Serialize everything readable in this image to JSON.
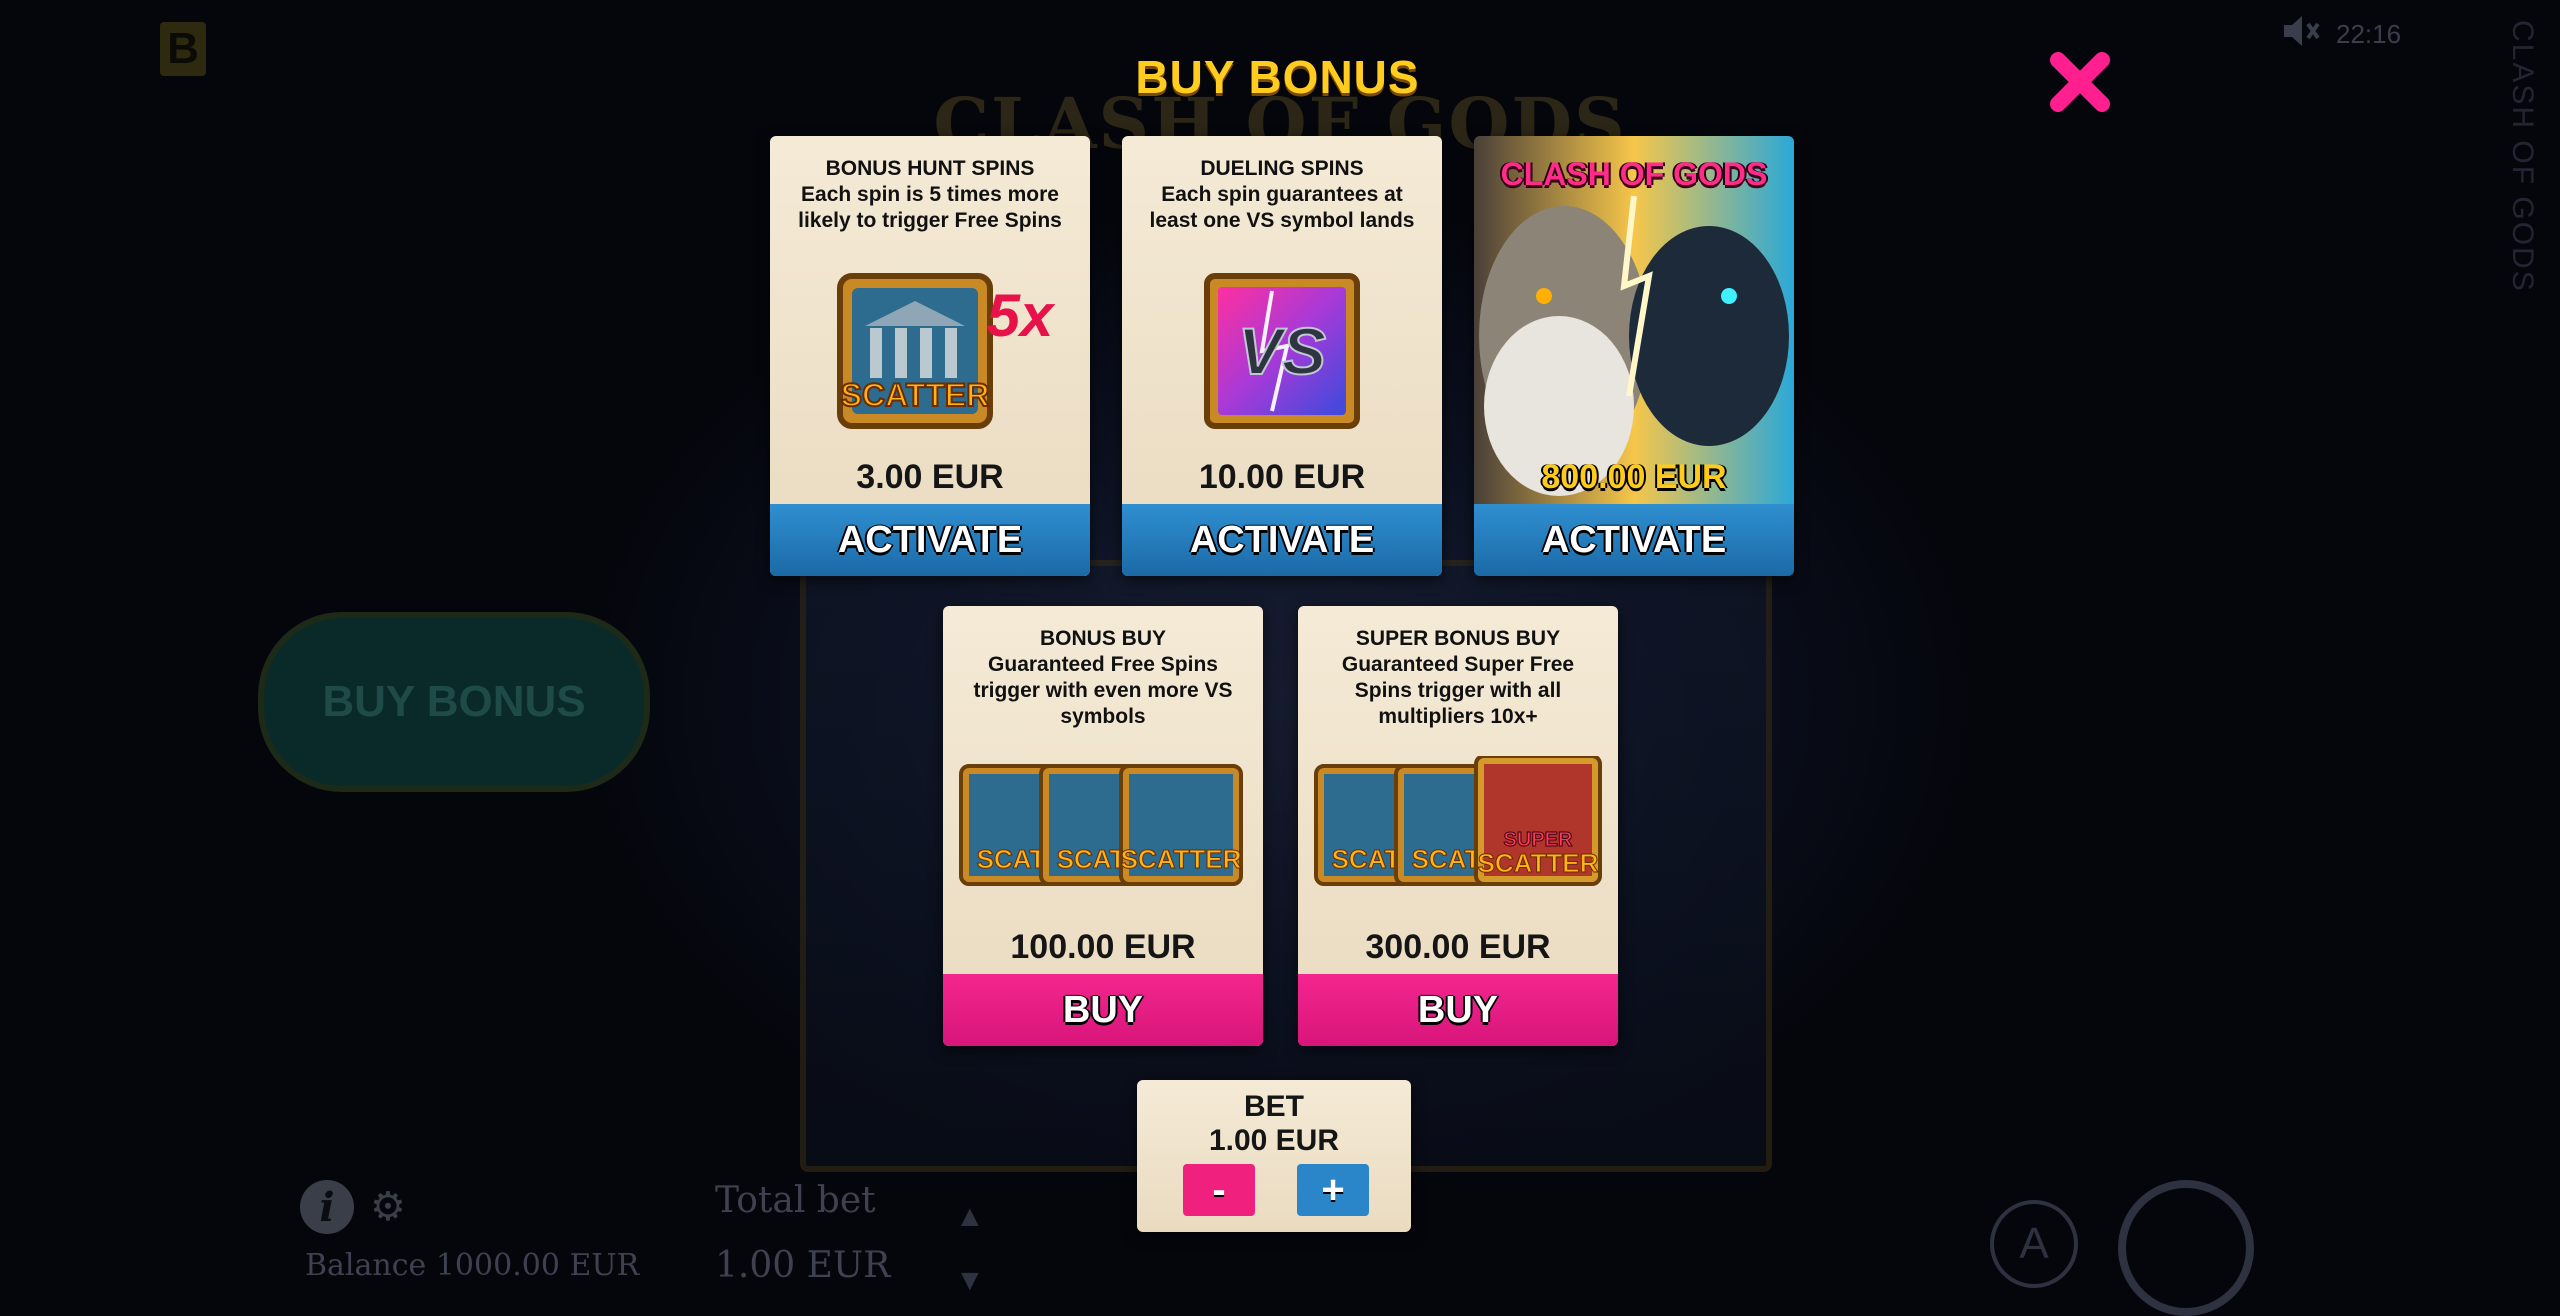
{
  "background": {
    "logo_letter": "B",
    "game_title": "CLASH OF GODS",
    "vertical_title": "CLASH OF GODS",
    "clock": "22:16",
    "buy_bonus_button": "BUY BONUS",
    "balance_label": "Balance",
    "balance_value": "1000.00",
    "balance_currency": "EUR",
    "total_bet_label": "Total bet",
    "total_bet_value": "1.00",
    "total_bet_currency": "EUR",
    "auto_label": "A"
  },
  "modal": {
    "title": "BUY BONUS",
    "cards": [
      {
        "name": "BONUS HUNT SPINS",
        "desc": "Each spin is 5 times more likely to trigger Free Spins",
        "art_badge": "5x",
        "art_label": "SCATTER",
        "price": "3.00 EUR",
        "action": "ACTIVATE"
      },
      {
        "name": "DUELING SPINS",
        "desc": "Each spin guarantees at least one VS symbol lands",
        "art_label": "VS",
        "price": "10.00 EUR",
        "action": "ACTIVATE"
      },
      {
        "name": "CLASH OF GODS",
        "price": "800.00 EUR",
        "action": "ACTIVATE"
      },
      {
        "name": "BONUS BUY",
        "desc": "Guaranteed Free Spins trigger with even more VS symbols",
        "art_labels": [
          "SCAT",
          "SCAT",
          "SCATTER"
        ],
        "price": "100.00 EUR",
        "action": "BUY"
      },
      {
        "name": "SUPER BONUS BUY",
        "desc": "Guaranteed Super Free Spins trigger with all multipliers 10x+",
        "art_labels": [
          "SCAT",
          "SCAT",
          "SUPER",
          "SCATTER"
        ],
        "price": "300.00 EUR",
        "action": "BUY"
      }
    ],
    "bet": {
      "label": "BET",
      "value": "1.00 EUR",
      "minus": "-",
      "plus": "+"
    }
  },
  "colors": {
    "title_gold": "#ffcc1f",
    "close_pink": "#ff1f8e",
    "activate_blue": "#1f7ac0",
    "buy_pink": "#e81b84",
    "card_parchment": "#f2e7d2"
  }
}
